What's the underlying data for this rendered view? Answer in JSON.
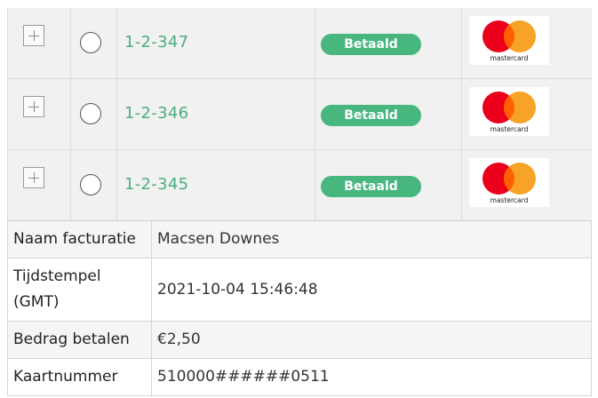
{
  "orders": [
    {
      "order_id": "1-2-347",
      "status": "Betaald",
      "card_brand": "mastercard",
      "card_label": "mastercard"
    },
    {
      "order_id": "1-2-346",
      "status": "Betaald",
      "card_brand": "mastercard",
      "card_label": "mastercard"
    },
    {
      "order_id": "1-2-345",
      "status": "Betaald",
      "card_brand": "mastercard",
      "card_label": "mastercard"
    }
  ],
  "details": [
    {
      "label": "Naam facturatie",
      "value": "Macsen Downes"
    },
    {
      "label": "Tijdstempel (GMT)",
      "value": "2021-10-04 15:46:48"
    },
    {
      "label": "Bedrag betalen",
      "value": "€2,50"
    },
    {
      "label": "Kaartnummer",
      "value": "510000######0511"
    }
  ],
  "colors": {
    "link": "#4caf7e",
    "badge": "#47b77f",
    "mc_red": "#eb001b",
    "mc_orange": "#f79e1b",
    "mc_overlap": "#ff5f00"
  }
}
